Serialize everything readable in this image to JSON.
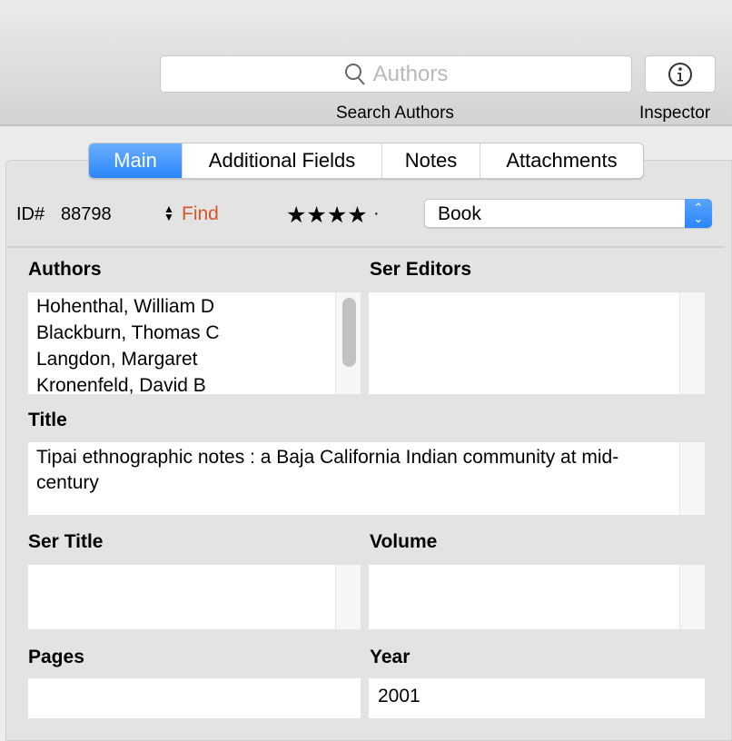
{
  "toolbar": {
    "search_placeholder": "Authors",
    "search_label": "Search Authors",
    "inspector_label": "Inspector"
  },
  "tabs": [
    {
      "label": "Main",
      "active": true
    },
    {
      "label": "Additional Fields"
    },
    {
      "label": "Notes"
    },
    {
      "label": "Attachments"
    }
  ],
  "record": {
    "id_label": "ID#",
    "id": "88798",
    "find_label": "Find",
    "rating_stars": "★★★★",
    "rating_dot": "·",
    "rating": 4,
    "type": "Book"
  },
  "colors": {
    "accent": "#2a86fb",
    "find": "#d4572a"
  },
  "fields": {
    "authors_label": "Authors",
    "authors": [
      "Hohenthal, William D",
      "Blackburn, Thomas C",
      "Langdon, Margaret",
      "Kronenfeld, David B"
    ],
    "ser_editors_label": "Ser Editors",
    "title_label": "Title",
    "title": "Tipai ethnographic notes : a Baja California Indian community at mid-century",
    "ser_title_label": "Ser Title",
    "volume_label": "Volume",
    "pages_label": "Pages",
    "year_label": "Year",
    "year": "2001"
  }
}
